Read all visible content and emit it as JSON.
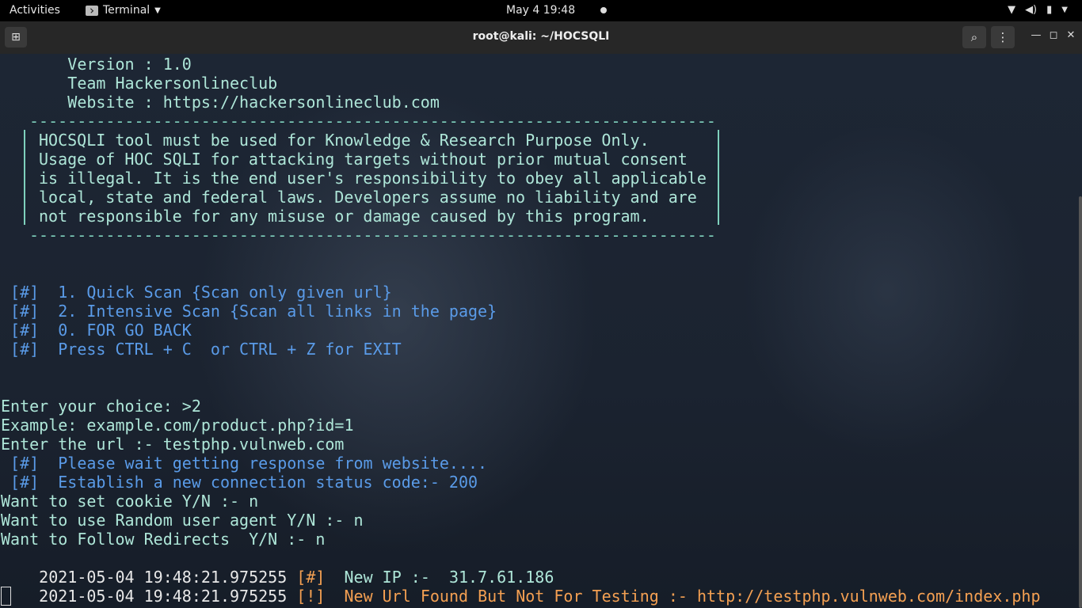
{
  "topbar": {
    "activities": "Activities",
    "app_menu": "Terminal",
    "clock": "May 4  19:48"
  },
  "window": {
    "title": "root@kali: ~/HOCSQLI"
  },
  "terminal": {
    "header": [
      "       Version : 1.0",
      "       Team Hackersonlineclub",
      "       Website : https://hackersonlineclub.com"
    ],
    "dashes": "------------------------------------------------------------------------",
    "disclaimer": [
      "HOCSQLI tool must be used for Knowledge & Research Purpose Only.",
      "Usage of HOC SQLI for attacking targets without prior mutual consent",
      "is illegal. It is the end user's responsibility to obey all applicable",
      "local, state and federal laws. Developers assume no liability and are",
      "not responsible for any misuse or damage caused by this program."
    ],
    "menu": [
      " [#]  1. Quick Scan {Scan only given url}",
      " [#]  2. Intensive Scan {Scan all links in the page}",
      " [#]  0. FOR GO BACK",
      " [#]  Press CTRL + C  or CTRL + Z for EXIT"
    ],
    "session": [
      "Enter your choice: >2",
      "Example: example.com/product.php?id=1",
      "Enter the url :- testphp.vulnweb.com"
    ],
    "status": [
      " [#]  Please wait getting response from website....",
      " [#]  Establish a new connection status code:- 200"
    ],
    "prompts": [
      "Want to set cookie Y/N :- n",
      "Want to use Random user agent Y/N :- n",
      "Want to Follow Redirects  Y/N :- n"
    ],
    "log1": {
      "timestamp": "2021-05-04 19:48:21.975255 ",
      "tag": "[#]",
      "message": "  New IP :-  31.7.61.186"
    },
    "log2": {
      "timestamp": "2021-05-04 19:48:21.975255 ",
      "tag": "[!]",
      "message": "  New Url Found But Not For Testing :- http://testphp.vulnweb.com/index.php"
    }
  }
}
